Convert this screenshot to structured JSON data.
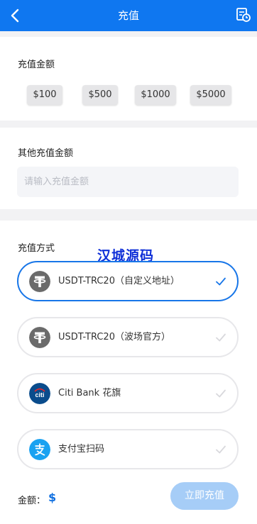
{
  "header": {
    "title": "充值",
    "back_icon": "chevron-left-icon",
    "history_icon": "receipt-clock-icon",
    "background": "#0f77f0"
  },
  "recharge_amount": {
    "title": "充值金额",
    "options": [
      "$100",
      "$500",
      "$1000",
      "$5000"
    ]
  },
  "other_amount": {
    "title": "其他充值金额",
    "placeholder": "请输入充值金额",
    "value": ""
  },
  "payment": {
    "title": "充值方式",
    "watermark": "汉城源码",
    "methods": [
      {
        "label": "USDT-TRC20（自定义地址）",
        "icon": "tether-icon",
        "selected": true
      },
      {
        "label": "USDT-TRC20（波场官方）",
        "icon": "tether-icon",
        "selected": false
      },
      {
        "label": "Citi Bank 花旗",
        "icon": "citi-icon",
        "selected": false
      },
      {
        "label": "支付宝扫码",
        "icon": "alipay-icon",
        "selected": false
      }
    ]
  },
  "footer": {
    "amount_label": "金额：",
    "currency": "$",
    "submit_label": "立即充值"
  },
  "colors": {
    "primary": "#0f77f0",
    "selected_border": "#1876e8",
    "submit_disabled": "#a6cdf7"
  }
}
